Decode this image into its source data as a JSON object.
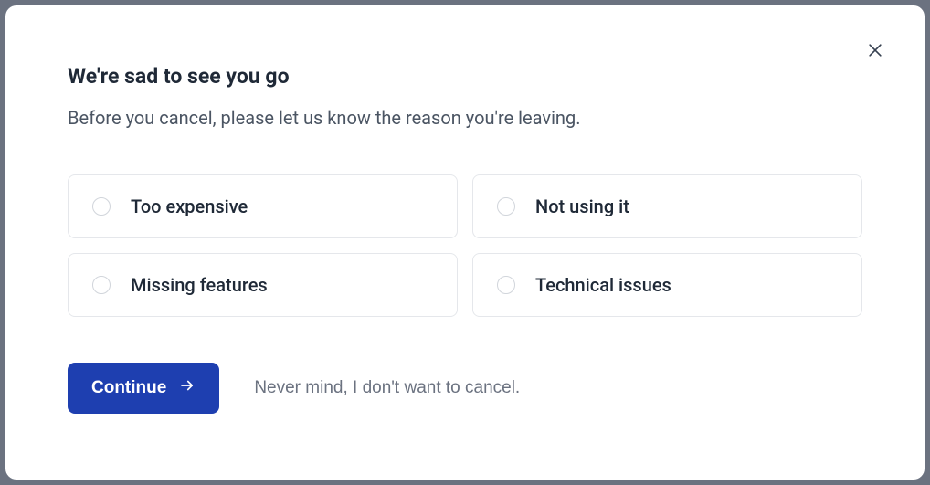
{
  "modal": {
    "title": "We're sad to see you go",
    "subtitle": "Before you cancel, please let us know the reason you're leaving.",
    "options": [
      {
        "label": "Too expensive"
      },
      {
        "label": "Not using it"
      },
      {
        "label": "Missing features"
      },
      {
        "label": "Technical issues"
      }
    ],
    "continue_label": "Continue",
    "nevermind_label": "Never mind, I don't want to cancel."
  }
}
